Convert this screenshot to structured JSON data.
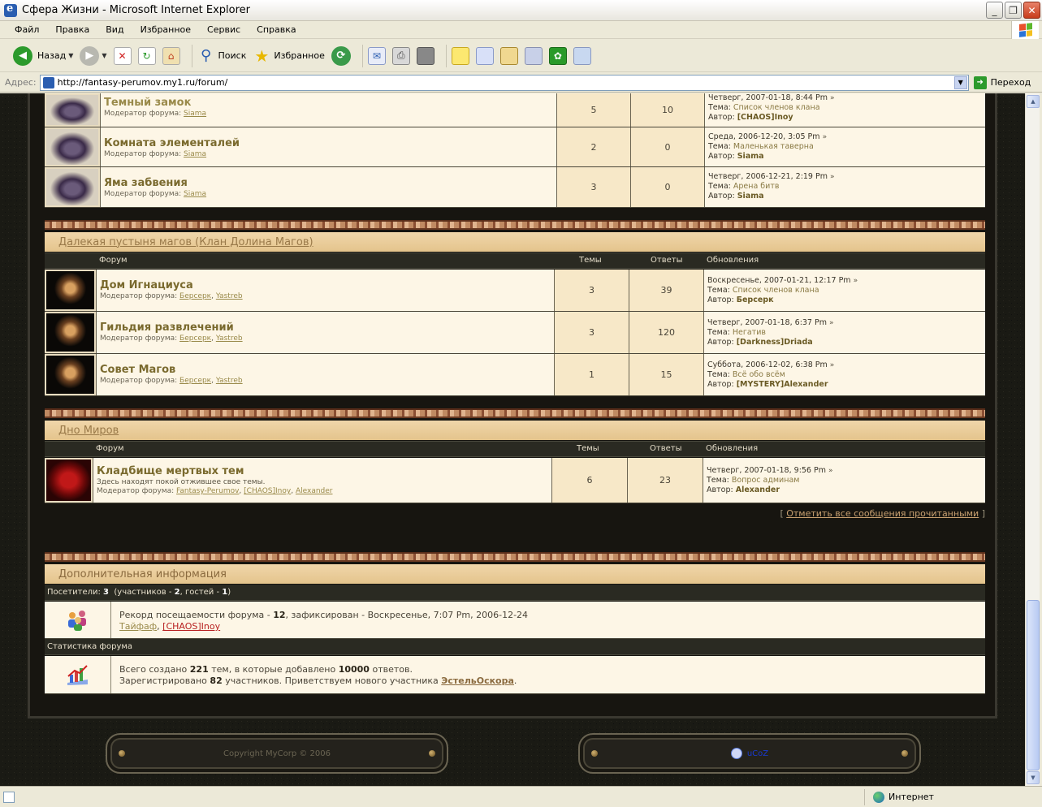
{
  "window": {
    "title": "Сфера Жизни - Microsoft Internet Explorer"
  },
  "menu": [
    "Файл",
    "Правка",
    "Вид",
    "Избранное",
    "Сервис",
    "Справка"
  ],
  "toolbar": {
    "back": "Назад",
    "search": "Поиск",
    "favorites": "Избранное"
  },
  "address": {
    "label": "Адрес:",
    "url": "http://fantasy-perumov.my1.ru/forum/",
    "go": "Переход"
  },
  "status": {
    "zone": "Интернет"
  },
  "section1": {
    "rows": [
      {
        "name": "Темный замок",
        "mod_label": "Модератор форума:",
        "mods": [
          "Siama"
        ],
        "topics": "5",
        "replies": "10",
        "upd_date": "Четверг, 2007-01-18, 8:44 Pm",
        "topic_label": "Тема:",
        "topic": "Список членов клана",
        "author_label": "Автор:",
        "author": "[CHAOS]Inoy"
      },
      {
        "name": "Комната элементалей",
        "mod_label": "Модератор форума:",
        "mods": [
          "Siama"
        ],
        "topics": "2",
        "replies": "0",
        "upd_date": "Среда, 2006-12-20, 3:05 Pm",
        "topic_label": "Тема:",
        "topic": "Маленькая таверна",
        "author_label": "Автор:",
        "author": "Siama"
      },
      {
        "name": "Яма забвения",
        "mod_label": "Модератор форума:",
        "mods": [
          "Siama"
        ],
        "topics": "3",
        "replies": "0",
        "upd_date": "Четверг, 2006-12-21, 2:19 Pm",
        "topic_label": "Тема:",
        "topic": "Арена битв",
        "author_label": "Автор:",
        "author": "Siama"
      }
    ]
  },
  "section2": {
    "title": "Далекая пустыня магов (Клан Долина Магов)",
    "cols": {
      "forum": "Форум",
      "topics": "Темы",
      "replies": "Ответы",
      "updates": "Обновления"
    },
    "rows": [
      {
        "name": "Дом Игнациуса",
        "mod_label": "Модератор форума:",
        "mods": [
          "Берсерк",
          "Yastreb"
        ],
        "topics": "3",
        "replies": "39",
        "upd_date": "Воскресенье, 2007-01-21, 12:17 Pm",
        "topic_label": "Тема:",
        "topic": "Список членов клана",
        "author_label": "Автор:",
        "author": "Берсерк"
      },
      {
        "name": "Гильдия развлечений",
        "mod_label": "Модератор форума:",
        "mods": [
          "Берсерк",
          "Yastreb"
        ],
        "topics": "3",
        "replies": "120",
        "upd_date": "Четверг, 2007-01-18, 6:37 Pm",
        "topic_label": "Тема:",
        "topic": "Негатив",
        "author_label": "Автор:",
        "author": "[Darkness]Driada"
      },
      {
        "name": "Совет Магов",
        "mod_label": "Модератор форума:",
        "mods": [
          "Берсерк",
          "Yastreb"
        ],
        "topics": "1",
        "replies": "15",
        "upd_date": "Суббота, 2006-12-02, 6:38 Pm",
        "topic_label": "Тема:",
        "topic": "Всё обо всём",
        "author_label": "Автор:",
        "author": "[MYSTERY]Alexander"
      }
    ]
  },
  "section3": {
    "title": "Дно Миров",
    "cols": {
      "forum": "Форум",
      "topics": "Темы",
      "replies": "Ответы",
      "updates": "Обновления"
    },
    "row": {
      "name": "Кладбище мертвых тем",
      "desc": "Здесь находят покой отжившее свое темы.",
      "mod_label": "Модератор форума:",
      "mods": [
        "Fantasy-Perumov",
        "[CHAOS]Inoy",
        "Alexander"
      ],
      "topics": "6",
      "replies": "23",
      "upd_date": "Четверг, 2007-01-18, 9:56 Pm",
      "topic_label": "Тема:",
      "topic": "Вопрос админам",
      "author_label": "Автор:",
      "author": "Alexander"
    }
  },
  "markread": {
    "open": "[",
    "link": "Отметить все сообщения прочитанными",
    "close": "]"
  },
  "info": {
    "title": "Дополнительная информация",
    "visitors": {
      "label": "Посетители:",
      "total": "3",
      "members_label": "(участников -",
      "members": "2",
      "guests_label": ", гостей -",
      "guests": "1",
      "close": ")"
    },
    "record": {
      "text1": "Рекорд посещаемости форума -",
      "count": "12",
      "text2": ", зафиксирован - Воскресенье, 7:07 Pm, 2006-12-24",
      "users": [
        "Тайфаф",
        "[CHAOS]Inoy"
      ]
    },
    "stats_title": "Статистика форума",
    "stats": {
      "t1": "Всего создано",
      "topics": "221",
      "t2": "тем, в которые добавлено",
      "replies": "10000",
      "t3": "ответов.",
      "t4": "Зарегистрировано",
      "members": "82",
      "t5": "участников. Приветствуем нового участника",
      "newest": "ЭстельОскора",
      "t6": "."
    }
  },
  "footer": {
    "copyright": "Copyright MyCorp © 2006",
    "ucoz": "uCoZ"
  }
}
